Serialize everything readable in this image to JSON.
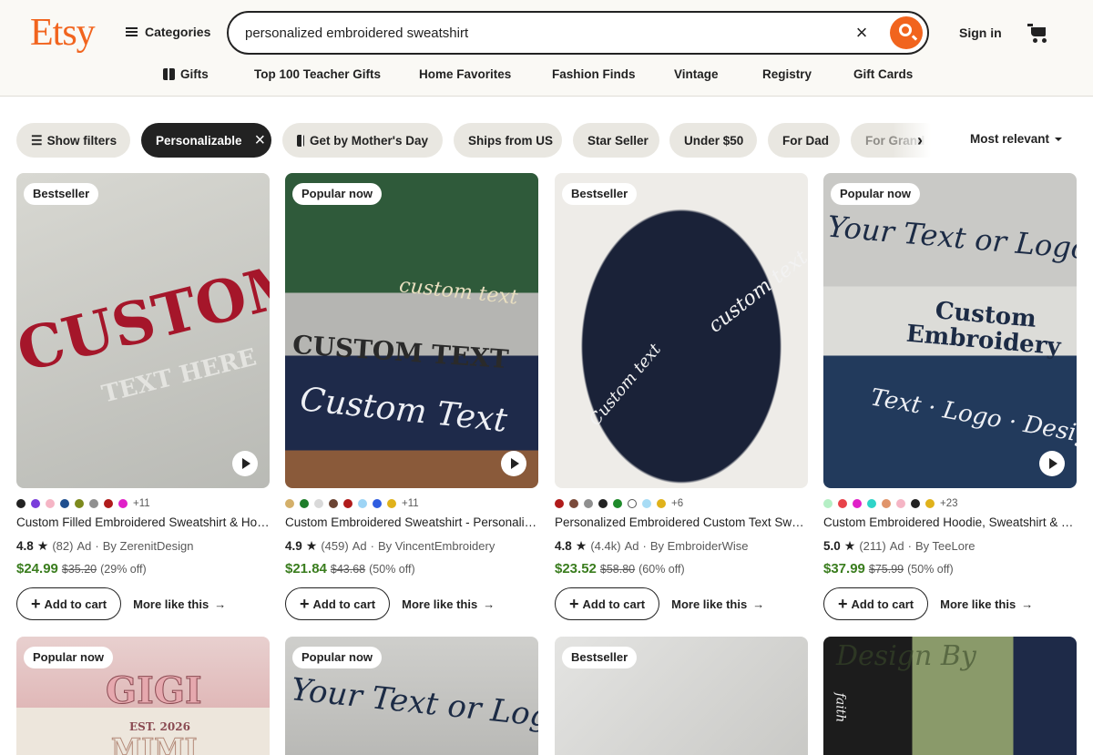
{
  "header": {
    "logo": "Etsy",
    "categories_label": "Categories",
    "search_value": "personalized embroidered sweatshirt",
    "sign_in": "Sign in"
  },
  "nav": [
    "Gifts",
    "Top 100 Teacher Gifts",
    "Home Favorites",
    "Fashion Finds",
    "Vintage",
    "Registry",
    "Gift Cards"
  ],
  "filters": {
    "show_filters": "Show filters",
    "chips": [
      "Personalizable",
      "Get by Mother's Day",
      "Ships from US",
      "Star Seller",
      "Under $50",
      "For Dad",
      "For Grand"
    ],
    "sort": "Most relevant"
  },
  "products": [
    {
      "badge": "Bestseller",
      "title": "Custom Filled Embroidered Sweatshirt & Hoodie",
      "rating": "4.8",
      "reviews": "(82)",
      "ad": "Ad",
      "seller": "By ZerenitDesign",
      "price": "$24.99",
      "original": "$35.20",
      "discount": "(29% off)",
      "more_colors": "+11",
      "swatches": [
        "#222222",
        "#7a3ddb",
        "#f5b5c5",
        "#1f4f8f",
        "#7d8a1d",
        "#8f8f8f",
        "#b01b1b",
        "#e020c8"
      ],
      "img_text1": "CUSTOM",
      "img_text2": "TEXT HERE"
    },
    {
      "badge": "Popular now",
      "title": "Custom Embroidered Sweatshirt - Personalized",
      "rating": "4.9",
      "reviews": "(459)",
      "ad": "Ad",
      "seller": "By VincentEmbroidery",
      "price": "$21.84",
      "original": "$43.68",
      "discount": "(50% off)",
      "more_colors": "+11",
      "swatches": [
        "#d4b06a",
        "#1e7d2a",
        "#d9d9d9",
        "#6b4433",
        "#b01b1b",
        "#9dd4f5",
        "#2f5de0",
        "#e0b21b"
      ],
      "img_text1": "custom text",
      "img_text2": "CUSTOM TEXT",
      "img_text3": "Custom Text"
    },
    {
      "badge": "Bestseller",
      "title": "Personalized Embroidered Custom Text Sweatshirt",
      "rating": "4.8",
      "reviews": "(4.4k)",
      "ad": "Ad",
      "seller": "By EmbroiderWise",
      "price": "$23.52",
      "original": "$58.80",
      "discount": "(60% off)",
      "more_colors": "+6",
      "swatches": [
        "#b01b1b",
        "#7a4a3a",
        "#8f8f8f",
        "#222222",
        "#1e8a2a",
        "#ffffff",
        "#a8dcf5",
        "#e0b21b"
      ],
      "img_text1": "custom text",
      "img_text2": "Custom text"
    },
    {
      "badge": "Popular now",
      "title": "Custom Embroidered Hoodie, Sweatshirt & Tee",
      "rating": "5.0",
      "reviews": "(211)",
      "ad": "Ad",
      "seller": "By TeeLore",
      "price": "$37.99",
      "original": "$75.99",
      "discount": "(50% off)",
      "more_colors": "+23",
      "swatches": [
        "#b5efc5",
        "#e8424a",
        "#e020c8",
        "#2fd4c8",
        "#e0946a",
        "#f5b5c5",
        "#222222",
        "#e0b21b"
      ],
      "img_text1": "Your Text or Logo",
      "img_text2": "Custom Embroidery",
      "img_text3": "Text · Logo · Design"
    },
    {
      "badge": "Popular now",
      "img_text1": "GIGI",
      "img_text2": "EST. 2026",
      "img_text3": "MIMI"
    },
    {
      "badge": "Popular now",
      "img_text1": "Your Text or Logo"
    },
    {
      "badge": "Bestseller",
      "img_text1": ""
    },
    {
      "badge": "",
      "img_text1": "Design By",
      "img_text2": "faith"
    }
  ],
  "add_to_cart": "Add to cart",
  "more_like_this": "More like this",
  "icons": {
    "search": "search-icon",
    "close": "close-icon",
    "cart": "cart-icon",
    "gift": "gift-icon",
    "filter": "filter-icon",
    "star": "star-icon",
    "play": "play-icon",
    "arrow": "arrow-right-icon"
  }
}
